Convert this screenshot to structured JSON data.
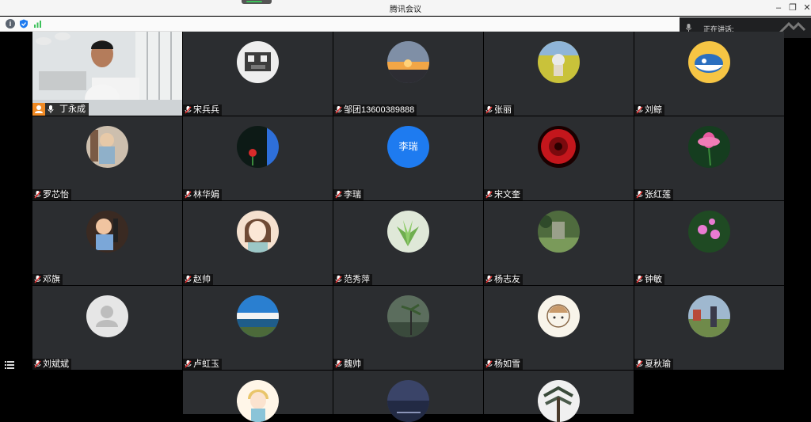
{
  "window": {
    "title": "腾讯会议"
  },
  "speaking": {
    "label": "正在讲话:"
  },
  "self": {
    "name": "丁永成"
  },
  "participants": [
    {
      "name": "宋兵兵",
      "avatar": "panda-illustration"
    },
    {
      "name": "邹团13600389888",
      "avatar": "sunset-photo"
    },
    {
      "name": "张丽",
      "avatar": "field-photo"
    },
    {
      "name": "刘鲸",
      "avatar": "whale-illustration"
    },
    {
      "name": "罗芯怡",
      "avatar": "child-photo"
    },
    {
      "name": "林华娟",
      "avatar": "flower-photo"
    },
    {
      "name": "李瑞",
      "avatar": "letter",
      "letter": "李瑞"
    },
    {
      "name": "宋文奎",
      "avatar": "red-flower-photo"
    },
    {
      "name": "张红莲",
      "avatar": "lotus-photo"
    },
    {
      "name": "邓旗",
      "avatar": "child-photo"
    },
    {
      "name": "赵帅",
      "avatar": "girl-illustration"
    },
    {
      "name": "范秀萍",
      "avatar": "succulent-photo"
    },
    {
      "name": "杨志友",
      "avatar": "garden-photo"
    },
    {
      "name": "钟敏",
      "avatar": "pink-flowers-photo"
    },
    {
      "name": "刘斌斌",
      "avatar": "default-user"
    },
    {
      "name": "卢虹玉",
      "avatar": "sea-photo"
    },
    {
      "name": "魏帅",
      "avatar": "palm-photo"
    },
    {
      "name": "杨如雪",
      "avatar": "sketch-illustration"
    },
    {
      "name": "夏秋瑜",
      "avatar": "park-photo"
    },
    {
      "name": "",
      "avatar": "girl-cartoon"
    },
    {
      "name": "",
      "avatar": "night-photo"
    },
    {
      "name": "",
      "avatar": "pine-photo"
    }
  ],
  "icons": {
    "info": "info-icon",
    "security": "shield-icon",
    "network": "signal-icon",
    "list": "list-icon",
    "mute": "mic-muted-icon"
  },
  "colors": {
    "tile": "#2b2d30",
    "accent": "#1e7bf0",
    "self_badge": "#f08a24"
  }
}
